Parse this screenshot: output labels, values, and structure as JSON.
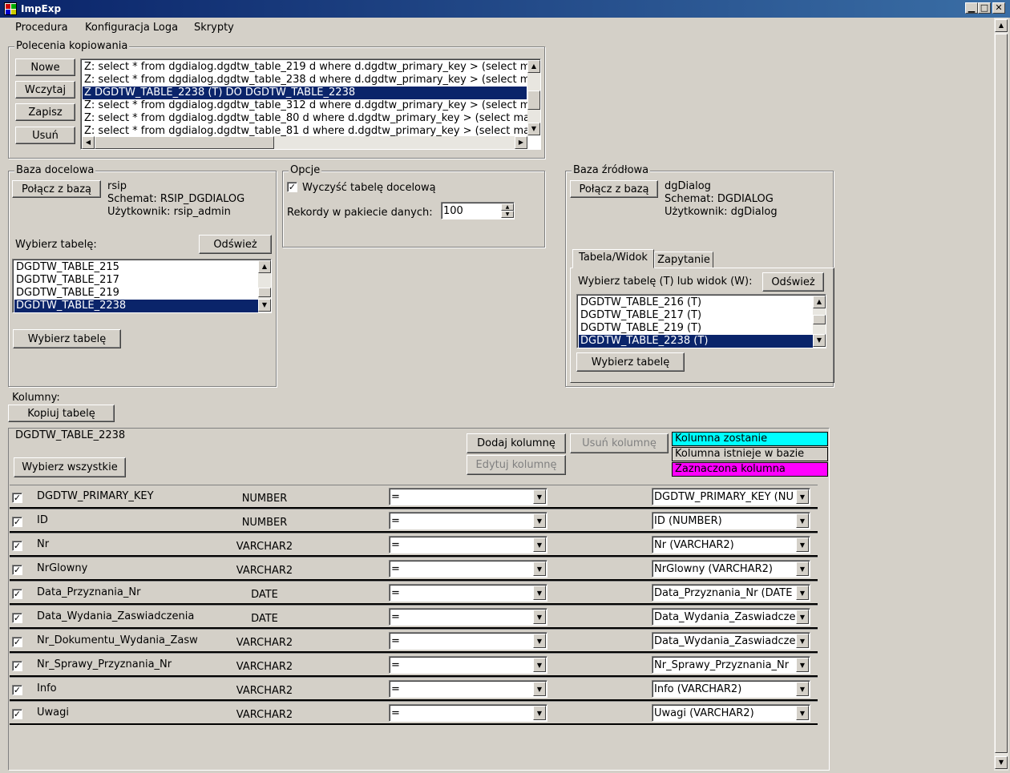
{
  "window": {
    "title": "ImpExp",
    "minimize": "▁",
    "maximize": "□",
    "close": "✕"
  },
  "menu": [
    "Procedura",
    "Konfiguracja Loga",
    "Skrypty"
  ],
  "copy_commands": {
    "title": "Polecenia kopiowania",
    "buttons": [
      "Nowe",
      "Wczytaj",
      "Zapisz",
      "Usuń"
    ],
    "items": [
      "Z: select * from dgdialog.dgdtw_table_219 d where d.dgdtw_primary_key > (select max",
      "Z: select * from dgdialog.dgdtw_table_238 d where d.dgdtw_primary_key > (select max",
      "Z DGDTW_TABLE_2238 (T) DO DGDTW_TABLE_2238",
      "Z: select * from dgdialog.dgdtw_table_312 d where d.dgdtw_primary_key > (select max",
      "Z: select * from dgdialog.dgdtw_table_80 d where d.dgdtw_primary_key > (select max",
      "Z: select * from dgdialog.dgdtw_table_81 d where d.dgdtw_primary_key > (select max"
    ],
    "selected_index": 2
  },
  "target_db": {
    "title": "Baza docelowa",
    "connect_label": "Połącz z bazą",
    "db_name": "rsip",
    "schema": "Schemat: RSIP_DGDIALOG",
    "user": "Użytkownik: rsip_admin",
    "choose_label": "Wybierz tabelę:",
    "refresh_label": "Odśwież",
    "tables": [
      "DGDTW_TABLE_215",
      "DGDTW_TABLE_217",
      "DGDTW_TABLE_219",
      "DGDTW_TABLE_2238"
    ],
    "selected_index": 3,
    "select_table_label": "Wybierz tabelę"
  },
  "options": {
    "title": "Opcje",
    "clear_label": "Wyczyść tabelę docelową",
    "clear_checked": true,
    "batch_label": "Rekordy w pakiecie danych:",
    "batch_value": "100"
  },
  "source_db": {
    "title": "Baza źródłowa",
    "connect_label": "Połącz z bazą",
    "db_name": "dgDialog",
    "schema": "Schemat: DGDIALOG",
    "user": "Użytkownik: dgDialog",
    "tabs": [
      "Tabela/Widok",
      "Zapytanie"
    ],
    "active_tab": 0,
    "choose_label": "Wybierz tabelę (T) lub widok (W):",
    "refresh_label": "Odśwież",
    "tables": [
      "DGDTW_TABLE_216 (T)",
      "DGDTW_TABLE_217 (T)",
      "DGDTW_TABLE_219 (T)",
      "DGDTW_TABLE_2238 (T)"
    ],
    "selected_index": 3,
    "select_table_label": "Wybierz tabelę"
  },
  "columns": {
    "label": "Kolumny:",
    "copy_table_label": "Kopiuj tabelę",
    "table_name": "DGDTW_TABLE_2238",
    "select_all_label": "Wybierz wszystkie",
    "add_column_label": "Dodaj kolumnę",
    "remove_column_label": "Usuń kolumnę",
    "edit_column_label": "Edytuj kolumnę",
    "legend": [
      {
        "text": "Kolumna zostanie",
        "color": "#00ffff"
      },
      {
        "text": "Kolumna istnieje w bazie",
        "color": "#d4d0c8"
      },
      {
        "text": "Zaznaczona kolumna",
        "color": "#ff00ff"
      }
    ],
    "rows": [
      {
        "checked": true,
        "name": "DGDTW_PRIMARY_KEY",
        "type": "NUMBER",
        "op": "=",
        "target": "DGDTW_PRIMARY_KEY (NU"
      },
      {
        "checked": true,
        "name": "ID",
        "type": "NUMBER",
        "op": "=",
        "target": "ID (NUMBER)"
      },
      {
        "checked": true,
        "name": "Nr",
        "type": "VARCHAR2",
        "op": "=",
        "target": "Nr (VARCHAR2)"
      },
      {
        "checked": true,
        "name": "NrGlowny",
        "type": "VARCHAR2",
        "op": "=",
        "target": "NrGlowny (VARCHAR2)"
      },
      {
        "checked": true,
        "name": "Data_Przyznania_Nr",
        "type": "DATE",
        "op": "=",
        "target": "Data_Przyznania_Nr (DATE"
      },
      {
        "checked": true,
        "name": "Data_Wydania_Zaswiadczenia",
        "type": "DATE",
        "op": "=",
        "target": "Data_Wydania_Zaswiadcze"
      },
      {
        "checked": true,
        "name": "Nr_Dokumentu_Wydania_Zasw",
        "type": "VARCHAR2",
        "op": "=",
        "target": "Data_Wydania_Zaswiadcze"
      },
      {
        "checked": true,
        "name": "Nr_Sprawy_Przyznania_Nr",
        "type": "VARCHAR2",
        "op": "=",
        "target": "Nr_Sprawy_Przyznania_Nr"
      },
      {
        "checked": true,
        "name": "Info",
        "type": "VARCHAR2",
        "op": "=",
        "target": "Info (VARCHAR2)"
      },
      {
        "checked": true,
        "name": "Uwagi",
        "type": "VARCHAR2",
        "op": "=",
        "target": "Uwagi (VARCHAR2)"
      }
    ]
  }
}
